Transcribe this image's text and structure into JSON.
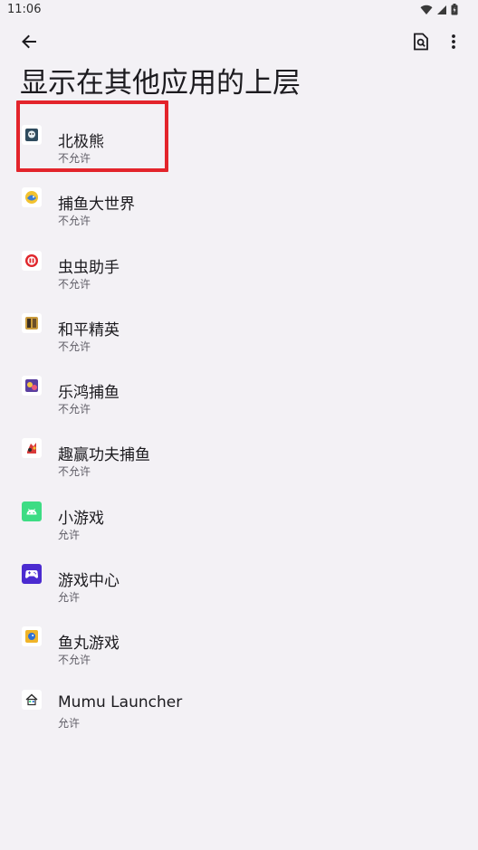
{
  "status_bar": {
    "time": "11:06",
    "icons": [
      "wifi-icon",
      "cellular-icon",
      "battery-icon"
    ]
  },
  "toolbar": {
    "back_icon": "arrow-back-icon",
    "search_icon": "search-document-icon",
    "more_icon": "more-vert-icon"
  },
  "page": {
    "title": "显示在其他应用的上层"
  },
  "colors": {
    "background": "#f3f1f5",
    "highlight": "#e3242b",
    "text_primary": "#1c1b1f",
    "text_secondary": "#5f5d66"
  },
  "apps": [
    {
      "name": "北极熊",
      "status": "不允许",
      "icon": "polar-bear-app-icon"
    },
    {
      "name": "捕鱼大世界",
      "status": "不允许",
      "icon": "fishing-world-app-icon"
    },
    {
      "name": "虫虫助手",
      "status": "不允许",
      "icon": "chongchong-helper-app-icon"
    },
    {
      "name": "和平精英",
      "status": "不允许",
      "icon": "peace-elite-app-icon"
    },
    {
      "name": "乐鸿捕鱼",
      "status": "不允许",
      "icon": "lehong-fishing-app-icon"
    },
    {
      "name": "趣赢功夫捕鱼",
      "status": "不允许",
      "icon": "kungfu-fishing-app-icon"
    },
    {
      "name": "小游戏",
      "status": "允许",
      "icon": "android-app-icon"
    },
    {
      "name": "游戏中心",
      "status": "允许",
      "icon": "gamepad-app-icon"
    },
    {
      "name": "鱼丸游戏",
      "status": "不允许",
      "icon": "yuwan-game-app-icon"
    },
    {
      "name": "Mumu Launcher",
      "status": "允许",
      "icon": "launcher-home-app-icon"
    }
  ]
}
